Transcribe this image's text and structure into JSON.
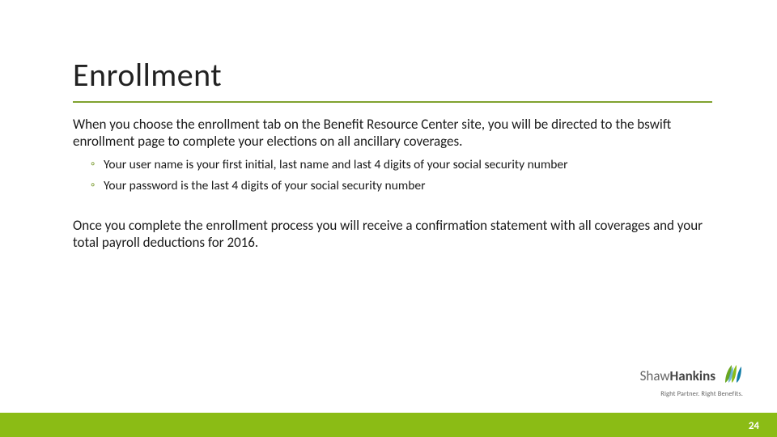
{
  "title": "Enrollment",
  "para1": "When you choose the enrollment tab on the Benefit Resource Center site, you will be directed to the bswift enrollment page to complete your elections on all ancillary coverages.",
  "bullets": [
    "Your user name is your first initial, last name and last 4 digits of your social security number",
    "Your password is the last 4 digits of your social security number"
  ],
  "para2": "Once you complete the enrollment process you will receive a confirmation statement with all coverages and your total payroll deductions for 2016.",
  "logo": {
    "name_first": "Shaw",
    "name_second": "Hankins",
    "tagline": "Right Partner. Right Benefits."
  },
  "page_number": "24",
  "colors": {
    "accent_rule": "#80a22f",
    "bottom_bar": "#8bbc15",
    "bullet_marker": "#7a9a2e"
  }
}
